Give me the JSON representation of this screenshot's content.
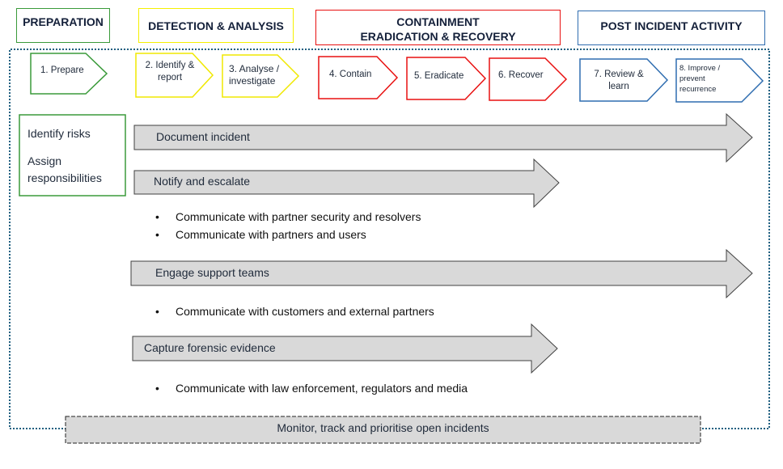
{
  "phases": [
    {
      "label": "PREPARATION",
      "color": "#3a9a3a"
    },
    {
      "label": "DETECTION & ANALYSIS",
      "color": "#f5f000"
    },
    {
      "label_line1": "CONTAINMENT",
      "label_line2": "ERADICATION & RECOVERY",
      "color": "#e81010"
    },
    {
      "label": "POST INCIDENT ACTIVITY",
      "color": "#2f6db0"
    }
  ],
  "steps": [
    {
      "label": "1. Prepare"
    },
    {
      "label": "2. Identify & report"
    },
    {
      "label": "3. Analyse / investigate"
    },
    {
      "label": "4. Contain"
    },
    {
      "label": "5. Eradicate"
    },
    {
      "label": "6. Recover"
    },
    {
      "label": "7. Review & learn"
    },
    {
      "label": "8. Improve / prevent recurrence"
    }
  ],
  "preparation_box": {
    "line1": "Identify risks",
    "line2": "Assign responsibilities"
  },
  "activities": [
    {
      "label": "Document incident"
    },
    {
      "label": "Notify and escalate",
      "bullets": [
        "Communicate with partner security and resolvers",
        "Communicate with partners and users"
      ]
    },
    {
      "label": "Engage support teams",
      "bullets": [
        "Communicate with customers and external partners"
      ]
    },
    {
      "label": "Capture forensic evidence",
      "bullets": [
        "Communicate with law enforcement, regulators and media"
      ]
    }
  ],
  "monitor": {
    "label": "Monitor, track and prioritise open incidents"
  },
  "colors": {
    "arrow_fill": "#d9d9d9",
    "arrow_stroke": "#404040",
    "container_border": "#1f5f80"
  }
}
